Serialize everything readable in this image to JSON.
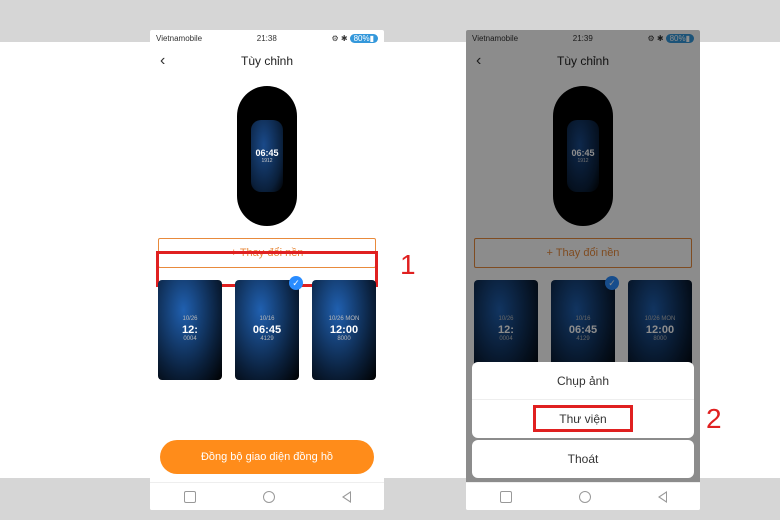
{
  "status": {
    "carrier": "Vietnamobile",
    "time_left": "21:38",
    "time_right": "21:39",
    "battery": "80%"
  },
  "header": {
    "title": "Tùy chỉnh",
    "back_glyph": "‹"
  },
  "band": {
    "screen_time": "06:45",
    "screen_sub": "1912"
  },
  "change_bg": {
    "label": "+ Thay đổi nền"
  },
  "annotations": {
    "one": "1",
    "two": "2"
  },
  "thumbs": [
    {
      "sub": "10/26",
      "main": "12:",
      "foot": "0004"
    },
    {
      "sub": "10/16",
      "main": "06:45",
      "foot": "4129",
      "checked": true
    },
    {
      "sub": "10/26 MON",
      "main": "12:00",
      "foot": "8000"
    }
  ],
  "sync": {
    "label": "Đồng bộ giao diện đồng hồ"
  },
  "sheet": {
    "camera": "Chụp ảnh",
    "gallery": "Thư viện",
    "cancel": "Thoát"
  }
}
